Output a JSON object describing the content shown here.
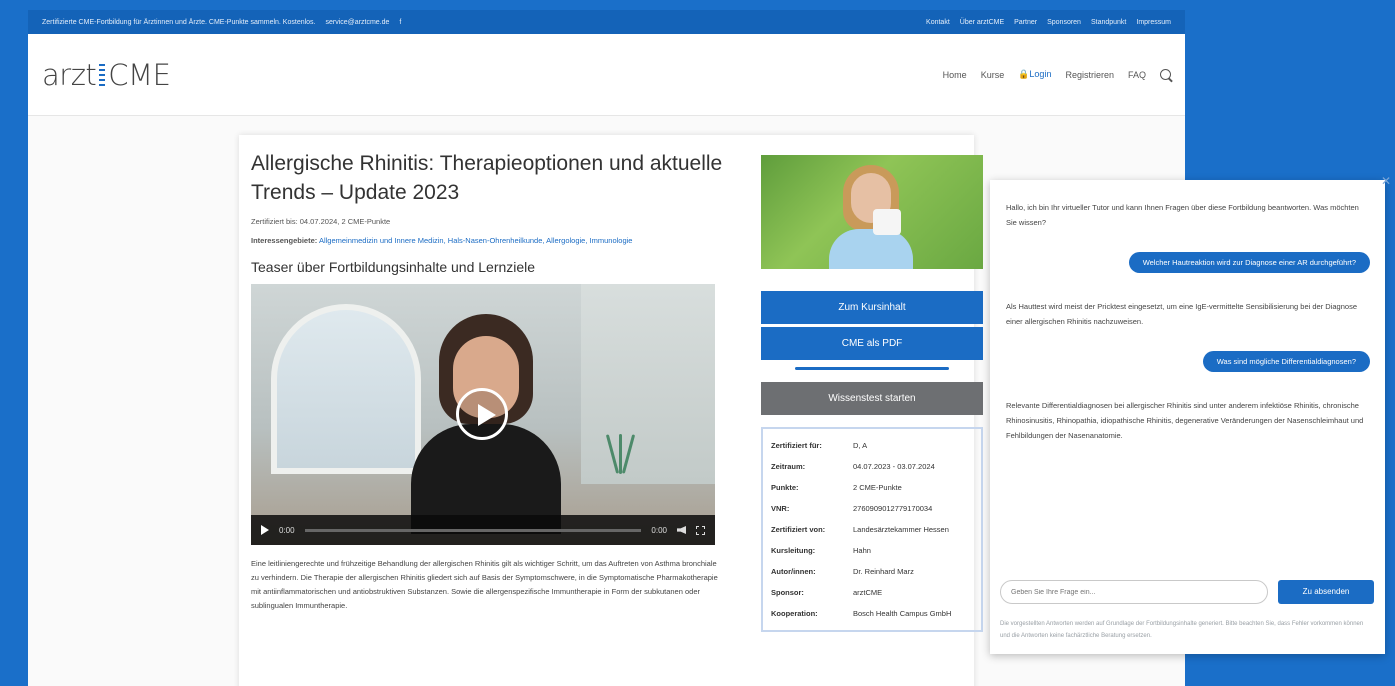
{
  "topbar": {
    "left_text": "Zertifizierte CME-Fortbildung für Ärztinnen und Ärzte. CME-Punkte sammeln. Kostenlos.",
    "email": "service@arztcme.de",
    "social_icon": "facebook-icon",
    "links": [
      "Kontakt",
      "Über arztCME",
      "Partner",
      "Sponsoren",
      "Standpunkt",
      "Impressum"
    ]
  },
  "header": {
    "logo_left": "arzt",
    "logo_right": "CME",
    "nav": [
      "Home",
      "Kurse",
      "Login",
      "Registrieren",
      "FAQ"
    ],
    "login_icon": "lock-icon",
    "search_icon": "search-icon"
  },
  "course": {
    "title": "Allergische Rhinitis: Therapieoptionen und aktuelle Trends – Update 2023",
    "meta": "Zertifiziert bis: 04.07.2024, 2 CME-Punkte",
    "interest_label": "Interessengebiete:",
    "interest_value": "Allgemeinmedizin und Innere Medizin, Hals-Nasen-Ohrenheilkunde, Allergologie, Immunologie",
    "teaser_title": "Teaser über Fortbildungsinhalte und Lernziele",
    "video_time": "0:00",
    "video_duration": "0:00",
    "description": "Eine leitliniengerechte und frühzeitige Behandlung der allergischen Rhinitis gilt als wichtiger Schritt, um das Auftreten von Asthma bronchiale zu verhindern. Die Therapie der allergischen Rhinitis gliedert sich auf Basis der Symptomschwere, in die Symptomatische Pharmakotherapie mit antiinflammatorischen und antiobstruktiven Substanzen. Sowie die allergenspezifische Immuntherapie in Form der subkutanen oder sublingualen Immuntherapie."
  },
  "sidebar": {
    "btn_kurs": "Zum Kursinhalt",
    "btn_pdf": "CME als PDF",
    "btn_test": "Wissenstest starten",
    "info": [
      {
        "k": "Zertifiziert für:",
        "v": "D, A"
      },
      {
        "k": "Zeitraum:",
        "v": "04.07.2023 - 03.07.2024"
      },
      {
        "k": "Punkte:",
        "v": "2 CME-Punkte"
      },
      {
        "k": "VNR:",
        "v": "2760909012779170034"
      },
      {
        "k": "Zertifiziert von:",
        "v": "Landesärztekammer Hessen"
      },
      {
        "k": "Kursleitung:",
        "v": "Hahn"
      },
      {
        "k": "Autor/innen:",
        "v": "Dr. Reinhard Marz"
      },
      {
        "k": "Sponsor:",
        "v": "arztCME"
      },
      {
        "k": "Kooperation:",
        "v": "Bosch Health Campus GmbH"
      }
    ]
  },
  "chat": {
    "close_icon": "close-icon",
    "messages": [
      {
        "role": "bot",
        "text": "Hallo, ich bin Ihr virtueller Tutor und kann Ihnen Fragen über diese Fortbildung beantworten. Was möchten Sie wissen?"
      },
      {
        "role": "user",
        "text": "Welcher Hautreaktion wird zur Diagnose einer AR durchgeführt?"
      },
      {
        "role": "bot",
        "text": "Als Hauttest wird meist der Pricktest eingesetzt, um eine IgE-vermittelte Sensibilisierung bei der Diagnose einer allergischen Rhinitis nachzuweisen."
      },
      {
        "role": "user",
        "text": "Was sind mögliche Differentialdiagnosen?"
      },
      {
        "role": "bot",
        "text": "Relevante Differentialdiagnosen bei allergischer Rhinitis sind unter anderem infektiöse Rhinitis, chronische Rhinosinusitis, Rhinopathia, idiopathische Rhinitis, degenerative Veränderungen der Nasenschleimhaut und Fehlbildungen der Nasenanatomie."
      }
    ],
    "input_placeholder": "Geben Sie Ihre Frage ein...",
    "send_label": "Zu absenden",
    "disclaimer": "Die vorgestellten Antworten werden auf Grundlage der Fortbildungsinhalte generiert. Bitte beachten Sie, dass Fehler vorkommen können und die Antworten keine fachärztliche Beratung ersetzen."
  }
}
